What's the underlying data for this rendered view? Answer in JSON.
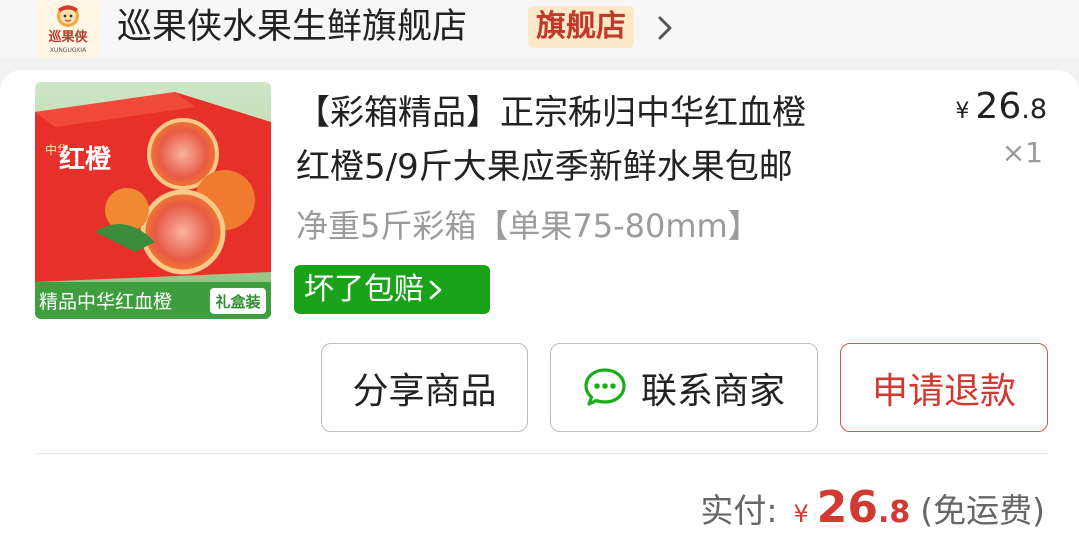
{
  "store": {
    "logo_text": "巡果侠",
    "logo_subtext": "XUNGUOXIA",
    "name": "巡果侠水果生鲜旗舰店",
    "badge": "旗舰店"
  },
  "product": {
    "title_line1": "【彩箱精品】正宗秭归中华红血橙",
    "title_line2": "红橙5/9斤大果应季新鲜水果包邮",
    "spec": "净重5斤彩箱【单果75-80mm】",
    "guarantee": "坏了包赔",
    "price_currency": "¥",
    "price_integer": "26",
    "price_decimal": ".8",
    "quantity": "×1",
    "image_text_brand": "中华",
    "image_text_main": "红橙",
    "image_banner": "精品中华红血橙",
    "image_banner_tag": "礼盒装"
  },
  "actions": {
    "share": "分享商品",
    "contact": "联系商家",
    "refund": "申请退款"
  },
  "summary": {
    "paid_label": "实付:",
    "currency": "¥",
    "total_integer": "26",
    "total_decimal": ".8",
    "shipping_note": "(免运费)"
  },
  "colors": {
    "accent_red": "#d03a30",
    "guarantee_green": "#1aa31a",
    "badge_bg": "#fde9c8"
  },
  "icons": {
    "chat": "wechat-chat-icon",
    "chevron": "chevron-right-icon"
  }
}
